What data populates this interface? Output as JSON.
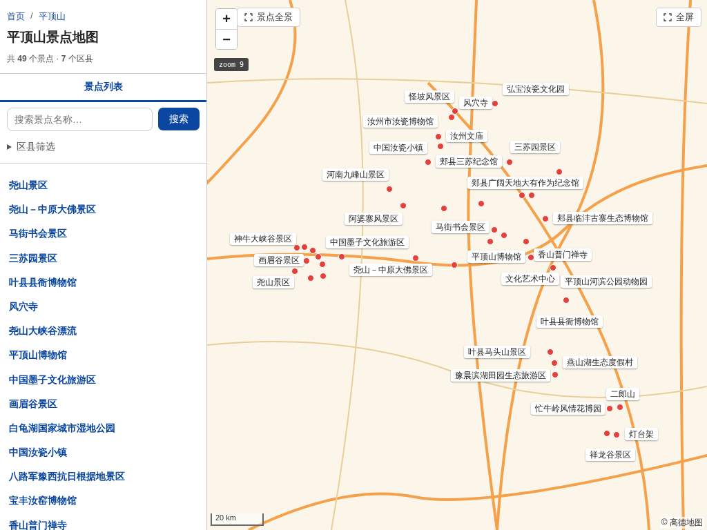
{
  "sidebar": {
    "breadcrumb": {
      "items": [
        "首页",
        "平顶山"
      ],
      "separator": "/"
    },
    "title": "平顶山景点地图",
    "summary": "共 **49** 个景点 · **7** 个区县",
    "tabs": [
      {
        "label": "景点列表",
        "selected": true
      }
    ],
    "search": {
      "placeholder": "搜索景点名称…",
      "button": "搜索"
    },
    "filter": {
      "label": "区县筛选",
      "expanded": false
    },
    "items": [
      "尧山景区",
      "尧山－中原大佛景区",
      "马街书会景区",
      "三苏园景区",
      "叶县县衙博物馆",
      "风穴寺",
      "尧山大峡谷漂流",
      "平顶山博物馆",
      "中国墨子文化旅游区",
      "画眉谷景区",
      "白龟湖国家城市湿地公园",
      "中国汝瓷小镇",
      "八路军豫西抗日根据地景区",
      "宝丰汝窑博物馆",
      "香山普门禅寺"
    ]
  },
  "map": {
    "zoom_in": "+",
    "zoom_out": "−",
    "overview_button": "景点全景",
    "zoom_badge": "zoom 9",
    "fullscreen_button": "全屏",
    "scale": "20 km",
    "attribution": "© 高德地图",
    "labels": [
      "怪坡风景区",
      "风穴寺",
      "弘宝汝瓷文化园",
      "汝州市汝瓷博物馆",
      "汝州文庙",
      "中国汝瓷小镇",
      "三苏园景区",
      "郏县三苏纪念馆",
      "河南九峰山景区",
      "郏县广阔天地大有作为纪念馆",
      "阿婆寨风景区",
      "郏县临沣古寨生态博物馆",
      "马街书会景区",
      "神牛大峡谷景区",
      "中国墨子文化旅游区",
      "香山普门禅寺",
      "平顶山博物馆",
      "画眉谷景区",
      "尧山－中原大佛景区",
      "文化艺术中心",
      "尧山景区",
      "平顶山河滨公园动物园",
      "叶县县衙博物馆",
      "叶县马头山景区",
      "燕山湖生态度假村",
      "豫晨滨湖田园生态旅游区",
      "二郎山",
      "忙牛岭风情花博园",
      "灯台架",
      "祥龙谷景区"
    ]
  }
}
